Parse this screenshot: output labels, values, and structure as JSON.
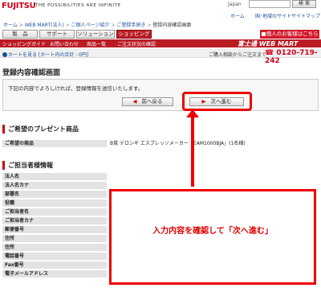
{
  "header": {
    "logo": "FUJITSU",
    "tagline": "THE POSSIBILITIES ARE INFINITE",
    "region": "Japan",
    "search_button": "検 索",
    "top_home": "ホーム",
    "region_link": "国･地域のサイト",
    "site_map": "サイトマップ"
  },
  "breadcrumb": {
    "items": [
      "ホーム",
      "WEB MART(法人)",
      "ご個人ページ紹介",
      "ご登録手続き"
    ],
    "current": "登録内容確認画面"
  },
  "nav": {
    "tabs": [
      "製　品",
      "サポート",
      "ソリューション",
      "ショッピング"
    ],
    "active_index": 3,
    "contact": "■個人のお客様はこちら"
  },
  "subnav": {
    "items": [
      "ショッピングガイド",
      "お問い合わせ",
      "商品一覧",
      "ご注文状況の確認"
    ],
    "brand": "富士通 WEB MART"
  },
  "cartbar": {
    "cart_link": "カートを見る [カート内の合計 : 0円]",
    "phone_note": "ご購入相談からご注文まで",
    "phone": "0120-719-242"
  },
  "confirm": {
    "title": "登録内容確認画面",
    "message": "下記の内容でよろしければ、登録情報を送信いたします。",
    "back": "前へ戻る",
    "next": "次へ進む"
  },
  "product_section": {
    "title": "ご希望のプレゼント商品",
    "label": "ご希望の商品",
    "value": "B賞 デロンギ エスプレッソメーカー「EAM1000BJA」(1名様)"
  },
  "contact_section": {
    "title": "ご担当者様情報",
    "fields": [
      "法人名",
      "法人名カナ",
      "部署名",
      "役職",
      "ご担当者名",
      "ご担当者カナ",
      "郵便番号",
      "住所",
      "住所",
      "電話番号",
      "Fax番号",
      "電子メールアドレス"
    ]
  },
  "annotation": {
    "text": "入力内容を確認して「次へ進む」",
    "color": "#e00000"
  }
}
